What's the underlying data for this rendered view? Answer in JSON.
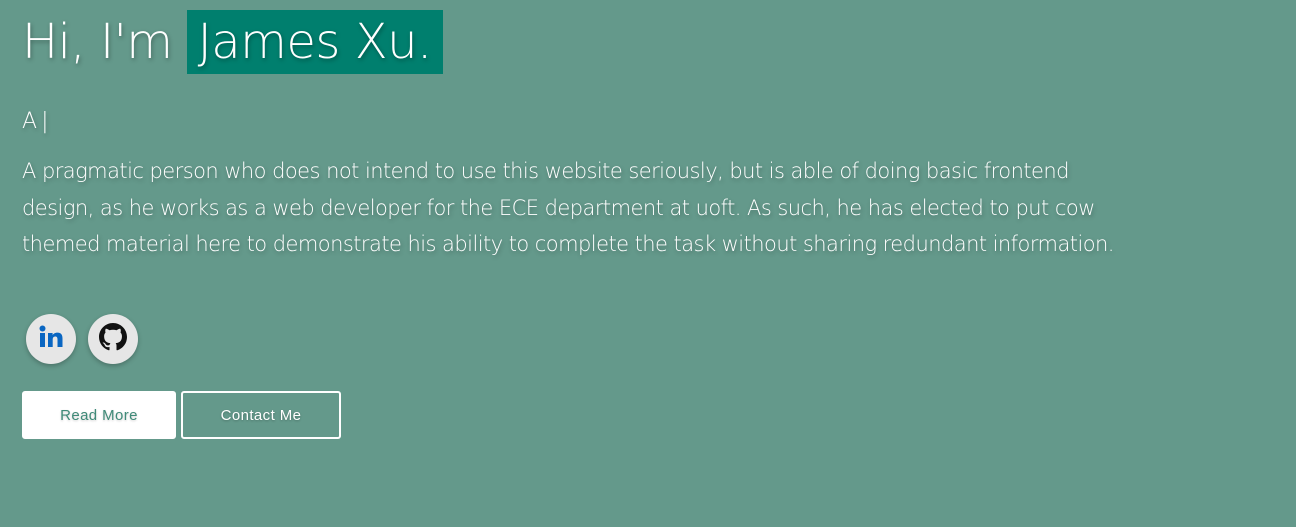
{
  "hero": {
    "greeting": "Hi, I'm",
    "name": "James Xu.",
    "typed_text": "A",
    "cursor": "|",
    "bio": "A pragmatic person who does not intend to use this website seriously, but is able of doing basic frontend design, as he works as a web developer for the ECE department at uoft. As such, he has elected to put cow themed material here to demonstrate his ability to complete the task without sharing redundant information."
  },
  "socials": [
    {
      "icon": "linkedin-icon"
    },
    {
      "icon": "github-icon"
    }
  ],
  "buttons": {
    "read_more": "Read More",
    "contact_me": "Contact Me"
  },
  "colors": {
    "background": "#64998b",
    "name_highlight": "#007f6e",
    "linkedin": "#0a66c2",
    "button_primary_text": "#3f8a78"
  }
}
